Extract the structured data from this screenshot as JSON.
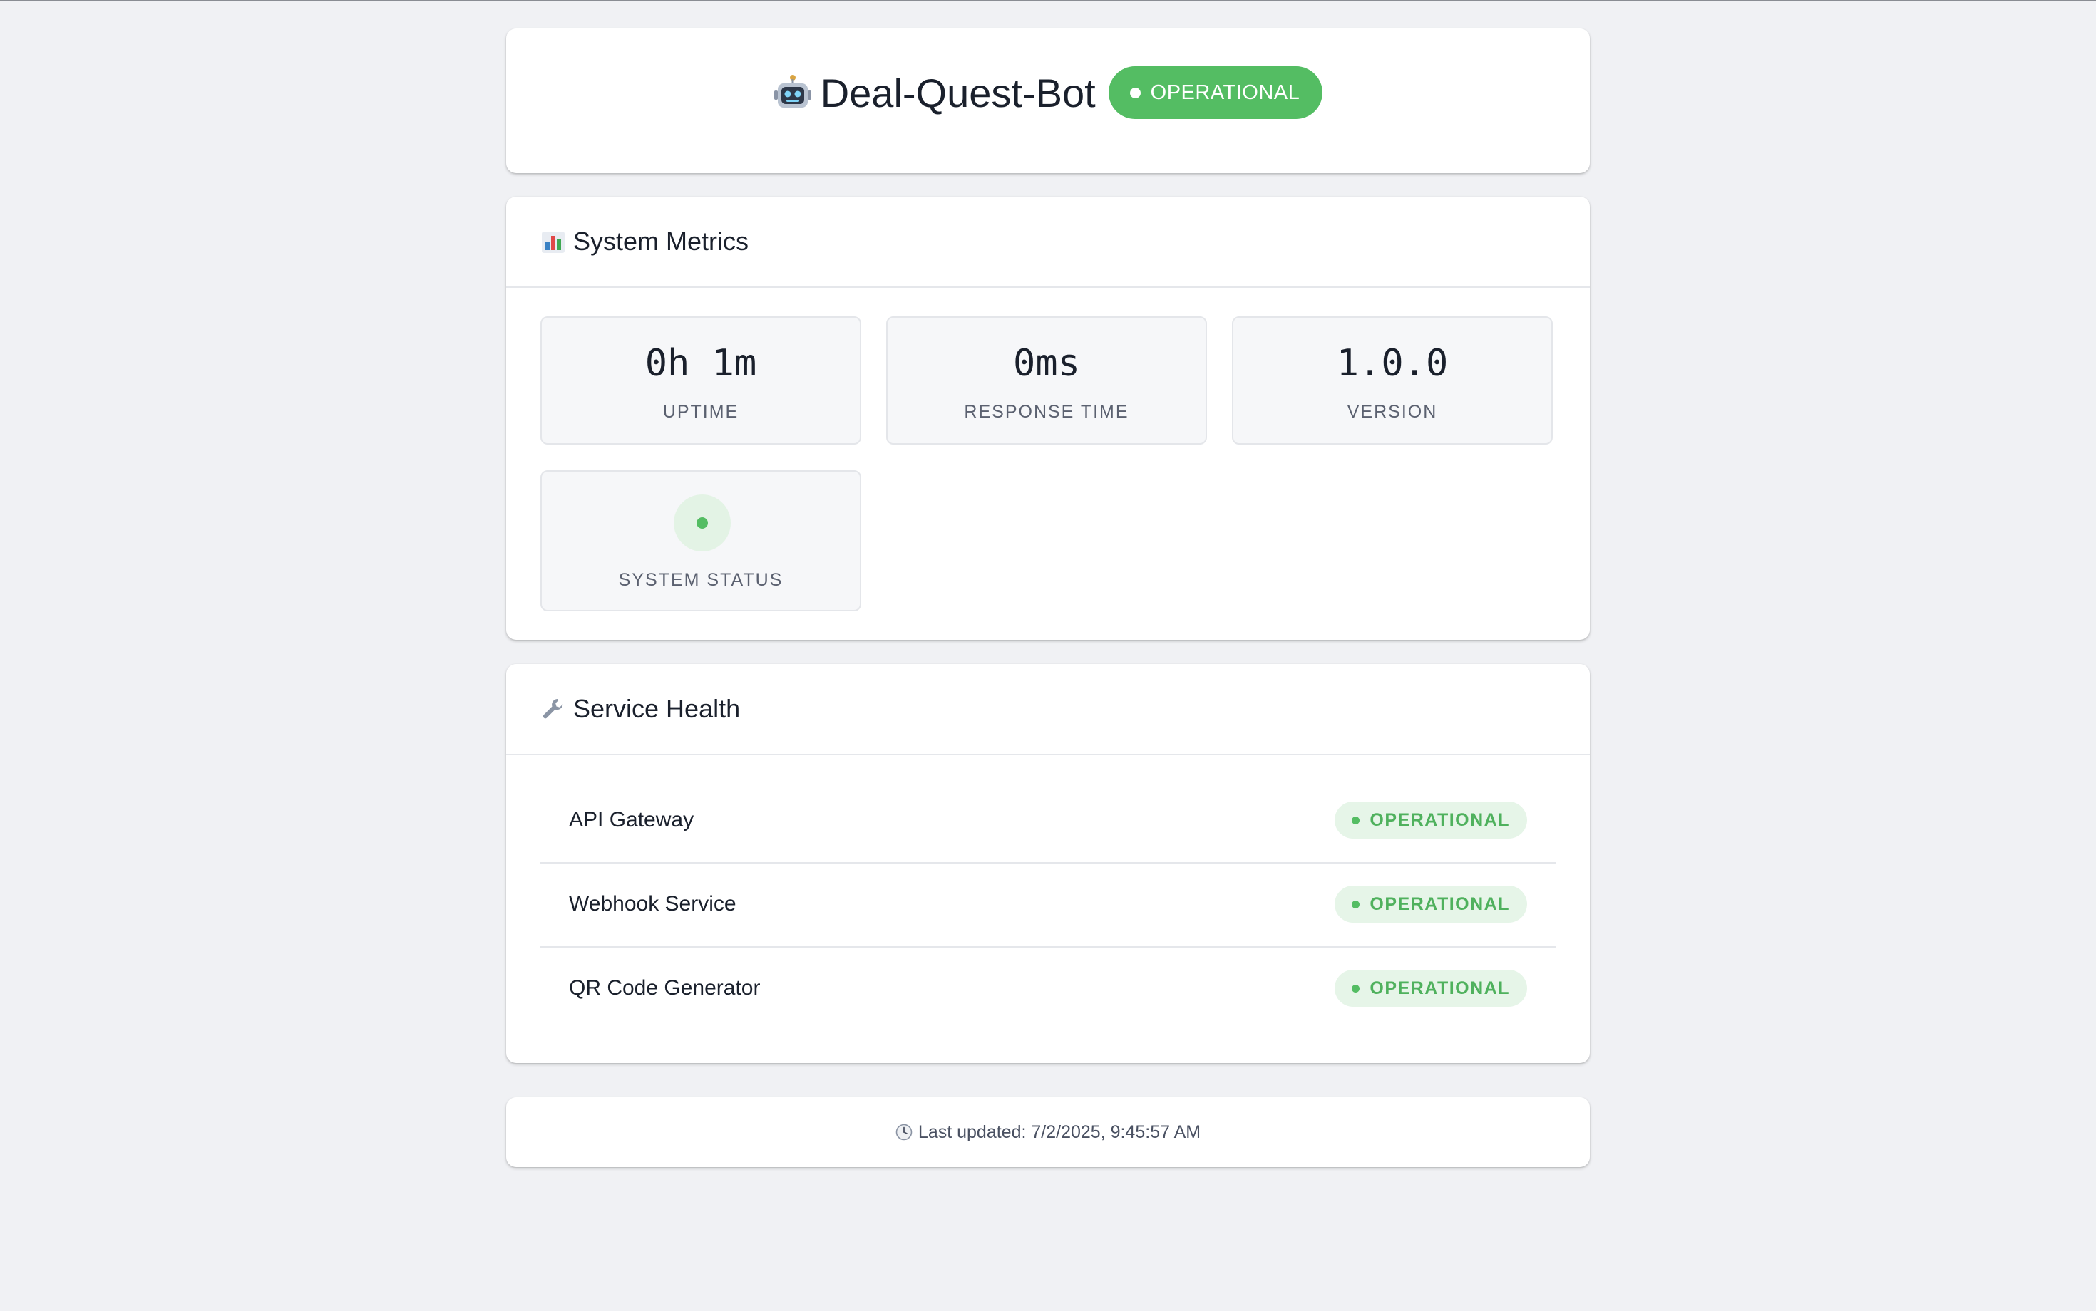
{
  "header": {
    "app_icon": "robot-icon",
    "app_name": "Deal-Quest-Bot",
    "status_label": "OPERATIONAL",
    "status_color": "#54bd63"
  },
  "metrics": {
    "icon": "bar-chart-icon",
    "title": "System Metrics",
    "tiles": [
      {
        "value": "0h 1m",
        "label": "UPTIME"
      },
      {
        "value": "0ms",
        "label": "RESPONSE TIME"
      },
      {
        "value": "1.0.0",
        "label": "VERSION"
      }
    ],
    "system_status": {
      "icon": "status-dot-icon",
      "label": "SYSTEM STATUS"
    }
  },
  "health": {
    "icon": "wrench-icon",
    "title": "Service Health",
    "services": [
      {
        "name": "API Gateway",
        "status": "OPERATIONAL"
      },
      {
        "name": "Webhook Service",
        "status": "OPERATIONAL"
      },
      {
        "name": "QR Code Generator",
        "status": "OPERATIONAL"
      }
    ]
  },
  "footer": {
    "icon": "clock-icon",
    "last_updated": "Last updated: 7/2/2025, 9:45:57 AM"
  }
}
